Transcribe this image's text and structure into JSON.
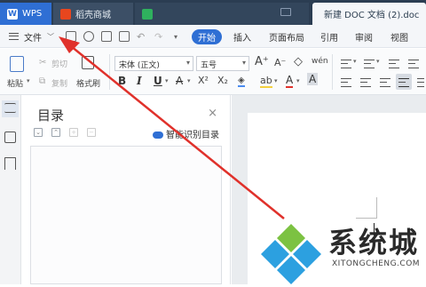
{
  "titlebar": {
    "tabs": [
      {
        "label": "WPS",
        "icon": "wps-logo-icon"
      },
      {
        "label": "稻壳商城",
        "icon": "daoke-icon"
      },
      {
        "label": "",
        "icon": "spreadsheet-icon"
      },
      {
        "label": "新建 DOC 文档 (2).doc",
        "icon": "document-icon"
      }
    ]
  },
  "menubar": {
    "file": "文件",
    "items": [
      "开始",
      "插入",
      "页面布局",
      "引用",
      "审阅",
      "视图"
    ]
  },
  "ribbon": {
    "paste": "粘贴",
    "cut": "剪切",
    "copy": "复制",
    "format_painter": "格式刷",
    "font_name": "宋体 (正文)",
    "font_size": "五号",
    "bold": "B",
    "italic": "I",
    "underline": "U",
    "strike": "A",
    "superscript": "X²",
    "subscript": "X₂",
    "highlight": "ab",
    "font_color": "A",
    "char_shade": "A",
    "grow_font": "A⁺",
    "shrink_font": "A⁻",
    "clear": "◇",
    "phonetic": "wén"
  },
  "toc": {
    "title": "目录",
    "close": "×",
    "smart_recognize": "智能识别目录"
  },
  "watermark": {
    "brand": "系统城",
    "url": "XITONGCHENG.COM"
  },
  "colors": {
    "accent": "#2f6fd4",
    "annotation_arrow": "#e0312b"
  }
}
